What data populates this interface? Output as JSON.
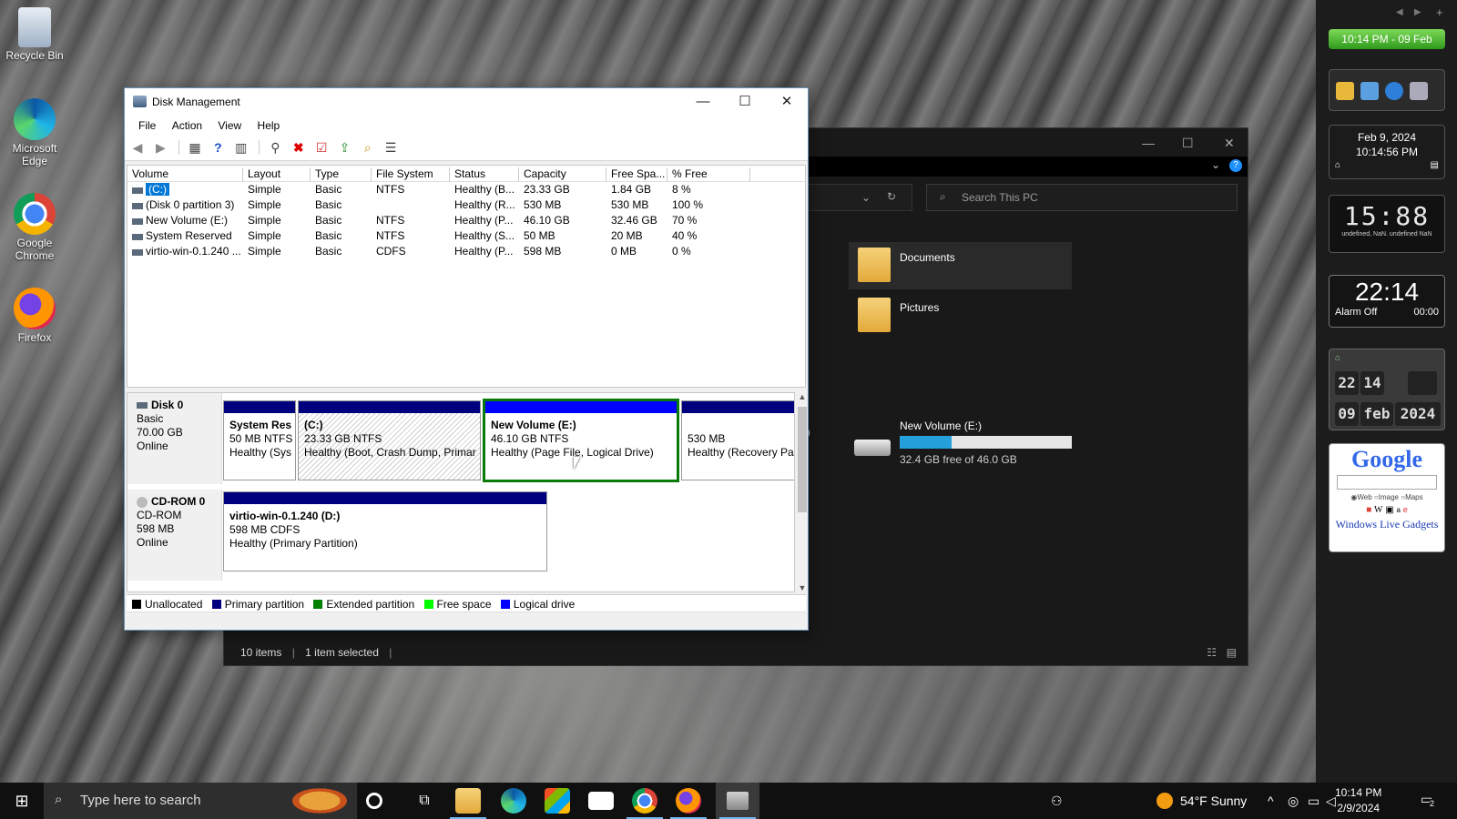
{
  "desktop": {
    "icons": [
      {
        "label": "Recycle Bin"
      },
      {
        "label": "Microsoft Edge"
      },
      {
        "label": "Google Chrome"
      },
      {
        "label": "Firefox"
      }
    ]
  },
  "explorer": {
    "search_placeholder": "Search This PC",
    "folders": [
      {
        "label": "Documents"
      },
      {
        "label": "Pictures"
      }
    ],
    "drive": {
      "label": "New Volume (E:)",
      "free_text": "32.4 GB free of 46.0 GB",
      "used_fraction": 0.3
    },
    "status_items": "10 items",
    "status_selected": "1 item selected",
    "partial_text": "0"
  },
  "disk_mgmt": {
    "title": "Disk Management",
    "menu": [
      "File",
      "Action",
      "View",
      "Help"
    ],
    "columns": [
      "Volume",
      "Layout",
      "Type",
      "File System",
      "Status",
      "Capacity",
      "Free Spa...",
      "% Free"
    ],
    "rows": [
      {
        "volume": "(C:)",
        "layout": "Simple",
        "type": "Basic",
        "fs": "NTFS",
        "status": "Healthy (B...",
        "capacity": "23.33 GB",
        "free": "1.84 GB",
        "pct": "8 %",
        "selected": true
      },
      {
        "volume": "(Disk 0 partition 3)",
        "layout": "Simple",
        "type": "Basic",
        "fs": "",
        "status": "Healthy (R...",
        "capacity": "530 MB",
        "free": "530 MB",
        "pct": "100 %"
      },
      {
        "volume": "New Volume (E:)",
        "layout": "Simple",
        "type": "Basic",
        "fs": "NTFS",
        "status": "Healthy (P...",
        "capacity": "46.10 GB",
        "free": "32.46 GB",
        "pct": "70 %"
      },
      {
        "volume": "System Reserved",
        "layout": "Simple",
        "type": "Basic",
        "fs": "NTFS",
        "status": "Healthy (S...",
        "capacity": "50 MB",
        "free": "20 MB",
        "pct": "40 %"
      },
      {
        "volume": "virtio-win-0.1.240 ...",
        "layout": "Simple",
        "type": "Basic",
        "fs": "CDFS",
        "status": "Healthy (P...",
        "capacity": "598 MB",
        "free": "0 MB",
        "pct": "0 %"
      }
    ],
    "disk0": {
      "name": "Disk 0",
      "type": "Basic",
      "size": "70.00 GB",
      "state": "Online",
      "partitions": [
        {
          "title": "System Res",
          "size": "50 MB NTFS",
          "status": "Healthy (Sys"
        },
        {
          "title": "(C:)",
          "size": "23.33 GB NTFS",
          "status": "Healthy (Boot, Crash Dump, Primar"
        },
        {
          "title": "New Volume  (E:)",
          "size": "46.10 GB NTFS",
          "status": "Healthy (Page File, Logical Drive)"
        },
        {
          "title": "",
          "size": "530 MB",
          "status": "Healthy (Recovery Pa"
        }
      ]
    },
    "cdrom0": {
      "name": "CD-ROM 0",
      "type": "CD-ROM",
      "size": "598 MB",
      "state": "Online",
      "partition": {
        "title": "virtio-win-0.1.240  (D:)",
        "size": "598 MB CDFS",
        "status": "Healthy (Primary Partition)"
      }
    },
    "legend": [
      {
        "label": "Unallocated",
        "color": "#000000"
      },
      {
        "label": "Primary partition",
        "color": "#00007f"
      },
      {
        "label": "Extended partition",
        "color": "#008000"
      },
      {
        "label": "Free space",
        "color": "#00ff00"
      },
      {
        "label": "Logical drive",
        "color": "#0000ff"
      }
    ]
  },
  "gadgets": {
    "green_clock": "10:14 PM - 09 Feb",
    "date_line1": "Feb 9, 2024",
    "date_line2": "10:14:56 PM",
    "digital_big": "15:88",
    "digital_small": "undefined, NaN. undefined NaN",
    "alarm_time": "22:14",
    "alarm_status": "Alarm Off",
    "alarm_timer": "00:00",
    "flip_hour": "22",
    "flip_min": "14",
    "flip_day": "09",
    "flip_month": "feb",
    "flip_year": "2024",
    "google_logo": "Google",
    "google_opts": [
      "Web",
      "Image",
      "Maps"
    ],
    "google_footer": "Windows Live Gadgets"
  },
  "taskbar": {
    "search_placeholder": "Type here to search",
    "weather": "54°F  Sunny",
    "time": "10:14 PM",
    "date": "2/9/2024",
    "notif_count": "2"
  }
}
